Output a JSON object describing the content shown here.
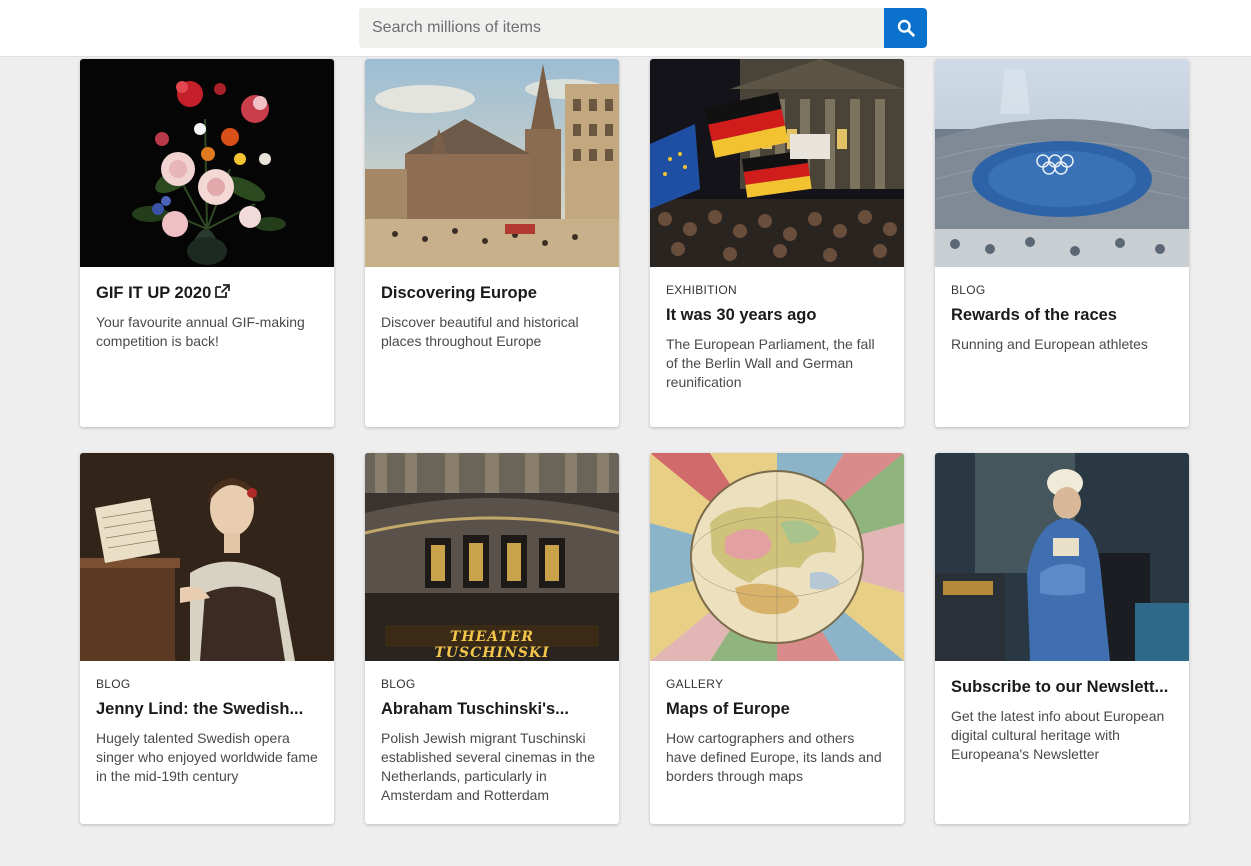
{
  "search": {
    "placeholder": "Search millions of items",
    "button_icon": "search-icon"
  },
  "colors": {
    "accent": "#0a72cc",
    "page_bg": "#eeeeee"
  },
  "cards": [
    {
      "kicker": "",
      "title": "GIF IT UP 2020",
      "external": true,
      "description": "Your favourite annual GIF-making competition is back!",
      "image": "flower-still-life-painting"
    },
    {
      "kicker": "",
      "title": "Discovering Europe",
      "external": false,
      "description": "Discover beautiful and historical places throughout Europe",
      "image": "cathedral-square-painting"
    },
    {
      "kicker": "EXHIBITION",
      "title": "It was 30 years ago",
      "external": false,
      "description": "The European Parliament, the fall of the Berlin Wall and German reunification",
      "image": "crowd-with-flags-photo"
    },
    {
      "kicker": "BLOG",
      "title": "Rewards of the races",
      "external": false,
      "description": "Running and European athletes",
      "image": "olympic-stadium-photo"
    },
    {
      "kicker": "BLOG",
      "title": "Jenny Lind: the Swedish...",
      "external": false,
      "description": "Hugely talented Swedish opera singer who enjoyed worldwide fame in the mid-19th century",
      "image": "woman-at-piano-painting"
    },
    {
      "kicker": "BLOG",
      "title": "Abraham Tuschinski's...",
      "external": false,
      "description": "Polish Jewish migrant Tuschinski established several cinemas in the Netherlands, particularly in Amsterdam and Rotterdam",
      "image": "theater-facade-photo",
      "image_text": "THEATER TUSCHINSKI"
    },
    {
      "kicker": "GALLERY",
      "title": "Maps of Europe",
      "external": false,
      "description": "How cartographers and others have defined Europe, its lands and borders through maps",
      "image": "antique-map-of-europe"
    },
    {
      "kicker": "",
      "title": "Subscribe to our Newslett...",
      "external": false,
      "description": "Get the latest info about European digital cultural heritage with Europeana's Newsletter",
      "image": "woman-reading-letter-painting"
    }
  ]
}
